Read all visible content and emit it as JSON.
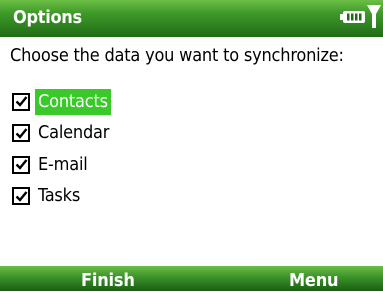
{
  "titlebar": {
    "title": "Options",
    "icons": [
      "battery-icon",
      "signal-icon"
    ]
  },
  "prompt": "Choose the data you want to synchronize:",
  "items": [
    {
      "label": "Contacts",
      "checked": true,
      "selected": true
    },
    {
      "label": "Calendar",
      "checked": true,
      "selected": false
    },
    {
      "label": "E-mail",
      "checked": true,
      "selected": false
    },
    {
      "label": "Tasks",
      "checked": true,
      "selected": false
    }
  ],
  "softkeys": {
    "left": "Finish",
    "right": "Menu"
  },
  "colors": {
    "bar_green": "#3f9a2a",
    "selection_green": "#39c929"
  }
}
